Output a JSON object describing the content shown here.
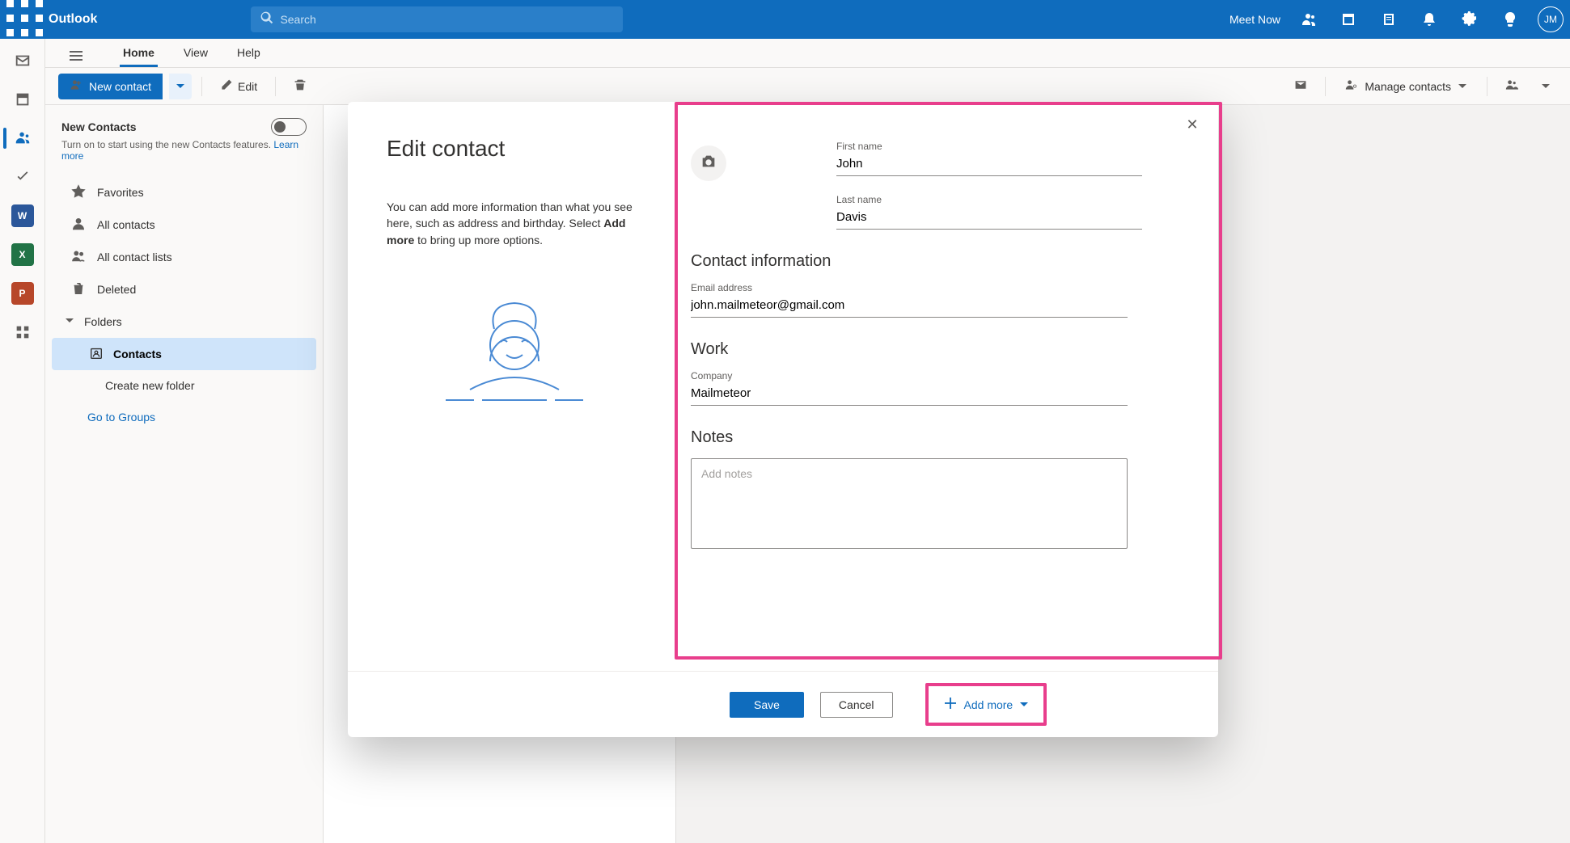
{
  "header": {
    "app_name": "Outlook",
    "search_placeholder": "Search",
    "meet_now_label": "Meet Now",
    "avatar_initials": "JM"
  },
  "tabs": {
    "home": "Home",
    "view": "View",
    "help": "Help"
  },
  "toolbar": {
    "new_contact": "New contact",
    "edit": "Edit",
    "manage_contacts": "Manage contacts"
  },
  "sidebar": {
    "promo_title": "New Contacts",
    "promo_body": "Turn on to start using the new Contacts features.  ",
    "promo_link": "Learn more",
    "favorites": "Favorites",
    "all_contacts": "All contacts",
    "all_contact_lists": "All contact lists",
    "deleted": "Deleted",
    "folders": "Folders",
    "contacts_sub": "Contacts",
    "create_new_folder": "Create new folder",
    "go_to_groups": "Go to Groups"
  },
  "modal": {
    "title": "Edit contact",
    "desc_pre": "You can add more information than what you see here, such as address and birthday. Select ",
    "desc_bold": "Add more",
    "desc_post": " to bring up more options.",
    "first_name_label": "First name",
    "first_name_value": "John",
    "last_name_label": "Last name",
    "last_name_value": "Davis",
    "contact_info_section": "Contact information",
    "email_label": "Email address",
    "email_value": "john.mailmeteor@gmail.com",
    "work_section": "Work",
    "company_label": "Company",
    "company_value": "Mailmeteor",
    "notes_section": "Notes",
    "notes_placeholder": "Add notes",
    "save_label": "Save",
    "cancel_label": "Cancel",
    "add_more_label": "Add more"
  }
}
